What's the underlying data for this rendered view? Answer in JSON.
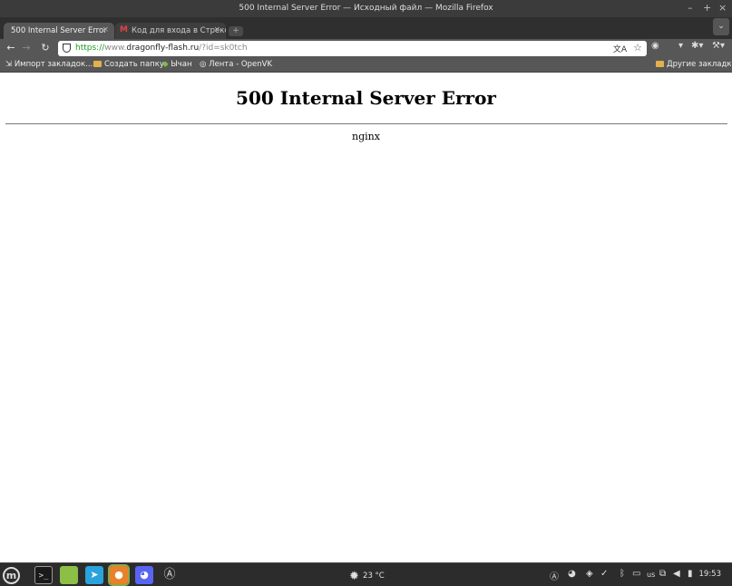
{
  "window": {
    "title": "500 Internal Server Error — Исходный файл — Mozilla Firefox",
    "controls": [
      "–",
      "+",
      "×"
    ]
  },
  "tabs": [
    {
      "label": "500 Internal Server Error",
      "active": true
    },
    {
      "label": "Код для входа в Стреко",
      "active": false
    }
  ],
  "navbar": {
    "url_scheme": "https://",
    "url_prefix": "www.",
    "url_host": "dragonfly-flash.ru",
    "url_path": "/?id=sk0tch"
  },
  "bookmarks": [
    {
      "label": "Импорт закладок..."
    },
    {
      "label": "Создать папку"
    },
    {
      "label": "Ычан"
    },
    {
      "label": "Лента - OpenVK"
    }
  ],
  "bookmarks_other": "Другие закладки",
  "page": {
    "heading": "500 Internal Server Error",
    "server": "nginx"
  },
  "taskbar": {
    "weather": "23 °C",
    "keyboard_layout": "us",
    "clock": "19:53"
  },
  "icons": {
    "back": "arrow-left-icon",
    "forward": "arrow-right-icon",
    "reload": "reload-icon",
    "security": "shield-icon",
    "translate": "translate-icon",
    "bookmark": "star-icon"
  }
}
